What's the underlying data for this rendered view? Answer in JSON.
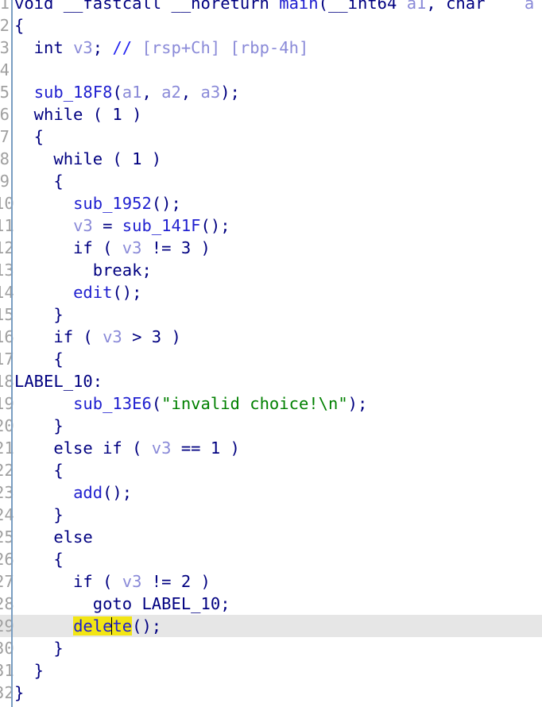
{
  "view": {
    "kind": "hex-rays-pseudocode",
    "colors": {
      "background": "#ffffff",
      "gutter_rule": "#7a9ec2",
      "line_number": "#a0a0a0",
      "current_line_highlight": "#e6e6e6",
      "selection_highlight": "#f2e514",
      "keyword": "#000080",
      "function": "#2020d0",
      "variable": "#8a8ad8",
      "string": "#008000",
      "comment": "#2020f0",
      "comment_text": "#8a8ad8",
      "caret": "#000000"
    },
    "current_line": 29,
    "selection_text": "delete",
    "caret_offset_in_selection": 4
  },
  "lines": [
    {
      "no": "1",
      "clipped_top": true,
      "clipped_right": true,
      "tokens": [
        {
          "text": "void ",
          "cls": "t-type"
        },
        {
          "text": "__fastcall __noreturn ",
          "cls": "t-kw"
        },
        {
          "text": "main",
          "cls": "t-fn"
        },
        {
          "text": "(",
          "cls": "t-plain"
        },
        {
          "text": "__int64 ",
          "cls": "t-type"
        },
        {
          "text": "a1",
          "cls": "t-var"
        },
        {
          "text": ", ",
          "cls": "t-plain"
        },
        {
          "text": "char ",
          "cls": "t-type"
        },
        {
          "text": "   a",
          "cls": "t-var"
        }
      ]
    },
    {
      "no": "2",
      "tokens": [
        {
          "text": "{",
          "cls": "t-plain"
        }
      ]
    },
    {
      "no": "3",
      "tokens": [
        {
          "text": "  int ",
          "cls": "t-type"
        },
        {
          "text": "v3",
          "cls": "t-var"
        },
        {
          "text": "; ",
          "cls": "t-plain"
        },
        {
          "text": "// ",
          "cls": "t-cmt"
        },
        {
          "text": "[rsp+Ch] [rbp-4h]",
          "cls": "t-cmttxt"
        }
      ]
    },
    {
      "no": "4",
      "tokens": [
        {
          "text": "",
          "cls": "t-plain"
        }
      ]
    },
    {
      "no": "5",
      "tokens": [
        {
          "text": "  ",
          "cls": "t-plain"
        },
        {
          "text": "sub_18F8",
          "cls": "t-fn"
        },
        {
          "text": "(",
          "cls": "t-plain"
        },
        {
          "text": "a1",
          "cls": "t-var"
        },
        {
          "text": ", ",
          "cls": "t-plain"
        },
        {
          "text": "a2",
          "cls": "t-var"
        },
        {
          "text": ", ",
          "cls": "t-plain"
        },
        {
          "text": "a3",
          "cls": "t-var"
        },
        {
          "text": ");",
          "cls": "t-plain"
        }
      ]
    },
    {
      "no": "6",
      "tokens": [
        {
          "text": "  while ( 1 )",
          "cls": "t-kw"
        }
      ]
    },
    {
      "no": "7",
      "tokens": [
        {
          "text": "  {",
          "cls": "t-plain"
        }
      ]
    },
    {
      "no": "8",
      "tokens": [
        {
          "text": "    while ( 1 )",
          "cls": "t-kw"
        }
      ]
    },
    {
      "no": "9",
      "tokens": [
        {
          "text": "    {",
          "cls": "t-plain"
        }
      ]
    },
    {
      "no": "10",
      "tokens": [
        {
          "text": "      ",
          "cls": "t-plain"
        },
        {
          "text": "sub_1952",
          "cls": "t-fn"
        },
        {
          "text": "();",
          "cls": "t-plain"
        }
      ]
    },
    {
      "no": "11",
      "tokens": [
        {
          "text": "      ",
          "cls": "t-plain"
        },
        {
          "text": "v3",
          "cls": "t-var"
        },
        {
          "text": " = ",
          "cls": "t-plain"
        },
        {
          "text": "sub_141F",
          "cls": "t-fn"
        },
        {
          "text": "();",
          "cls": "t-plain"
        }
      ]
    },
    {
      "no": "12",
      "tokens": [
        {
          "text": "      if ( ",
          "cls": "t-kw"
        },
        {
          "text": "v3",
          "cls": "t-var"
        },
        {
          "text": " != 3 )",
          "cls": "t-plain"
        }
      ]
    },
    {
      "no": "13",
      "tokens": [
        {
          "text": "        break;",
          "cls": "t-kw"
        }
      ]
    },
    {
      "no": "14",
      "tokens": [
        {
          "text": "      ",
          "cls": "t-plain"
        },
        {
          "text": "edit",
          "cls": "t-fn"
        },
        {
          "text": "();",
          "cls": "t-plain"
        }
      ]
    },
    {
      "no": "15",
      "tokens": [
        {
          "text": "    }",
          "cls": "t-plain"
        }
      ]
    },
    {
      "no": "16",
      "tokens": [
        {
          "text": "    if ( ",
          "cls": "t-kw"
        },
        {
          "text": "v3",
          "cls": "t-var"
        },
        {
          "text": " > 3 )",
          "cls": "t-plain"
        }
      ]
    },
    {
      "no": "17",
      "tokens": [
        {
          "text": "    {",
          "cls": "t-plain"
        }
      ]
    },
    {
      "no": "18",
      "tokens": [
        {
          "text": "LABEL_10:",
          "cls": "t-label"
        }
      ]
    },
    {
      "no": "19",
      "tokens": [
        {
          "text": "      ",
          "cls": "t-plain"
        },
        {
          "text": "sub_13E6",
          "cls": "t-fn"
        },
        {
          "text": "(",
          "cls": "t-plain"
        },
        {
          "text": "\"invalid choice!\\n\"",
          "cls": "t-str"
        },
        {
          "text": ");",
          "cls": "t-plain"
        }
      ]
    },
    {
      "no": "20",
      "tokens": [
        {
          "text": "    }",
          "cls": "t-plain"
        }
      ]
    },
    {
      "no": "21",
      "tokens": [
        {
          "text": "    else if ( ",
          "cls": "t-kw"
        },
        {
          "text": "v3",
          "cls": "t-var"
        },
        {
          "text": " == 1 )",
          "cls": "t-plain"
        }
      ]
    },
    {
      "no": "22",
      "tokens": [
        {
          "text": "    {",
          "cls": "t-plain"
        }
      ]
    },
    {
      "no": "23",
      "tokens": [
        {
          "text": "      ",
          "cls": "t-plain"
        },
        {
          "text": "add",
          "cls": "t-fn"
        },
        {
          "text": "();",
          "cls": "t-plain"
        }
      ]
    },
    {
      "no": "24",
      "tokens": [
        {
          "text": "    }",
          "cls": "t-plain"
        }
      ]
    },
    {
      "no": "25",
      "tokens": [
        {
          "text": "    else",
          "cls": "t-kw"
        }
      ]
    },
    {
      "no": "26",
      "tokens": [
        {
          "text": "    {",
          "cls": "t-plain"
        }
      ]
    },
    {
      "no": "27",
      "tokens": [
        {
          "text": "      if ( ",
          "cls": "t-kw"
        },
        {
          "text": "v3",
          "cls": "t-var"
        },
        {
          "text": " != 2 )",
          "cls": "t-plain"
        }
      ]
    },
    {
      "no": "28",
      "tokens": [
        {
          "text": "        goto ",
          "cls": "t-kw"
        },
        {
          "text": "LABEL_10",
          "cls": "t-label"
        },
        {
          "text": ";",
          "cls": "t-plain"
        }
      ]
    },
    {
      "no": "29",
      "current": true,
      "tokens": [
        {
          "text": "      ",
          "cls": "t-plain"
        },
        {
          "text": "dele",
          "cls": "t-fn",
          "sel": true
        },
        {
          "text": "",
          "cls": "caret"
        },
        {
          "text": "te",
          "cls": "t-fn",
          "sel": true
        },
        {
          "text": "();",
          "cls": "t-plain"
        }
      ]
    },
    {
      "no": "30",
      "tokens": [
        {
          "text": "    }",
          "cls": "t-plain"
        }
      ]
    },
    {
      "no": "31",
      "tokens": [
        {
          "text": "  }",
          "cls": "t-plain"
        }
      ]
    },
    {
      "no": "32",
      "tokens": [
        {
          "text": "}",
          "cls": "t-plain"
        }
      ]
    }
  ]
}
